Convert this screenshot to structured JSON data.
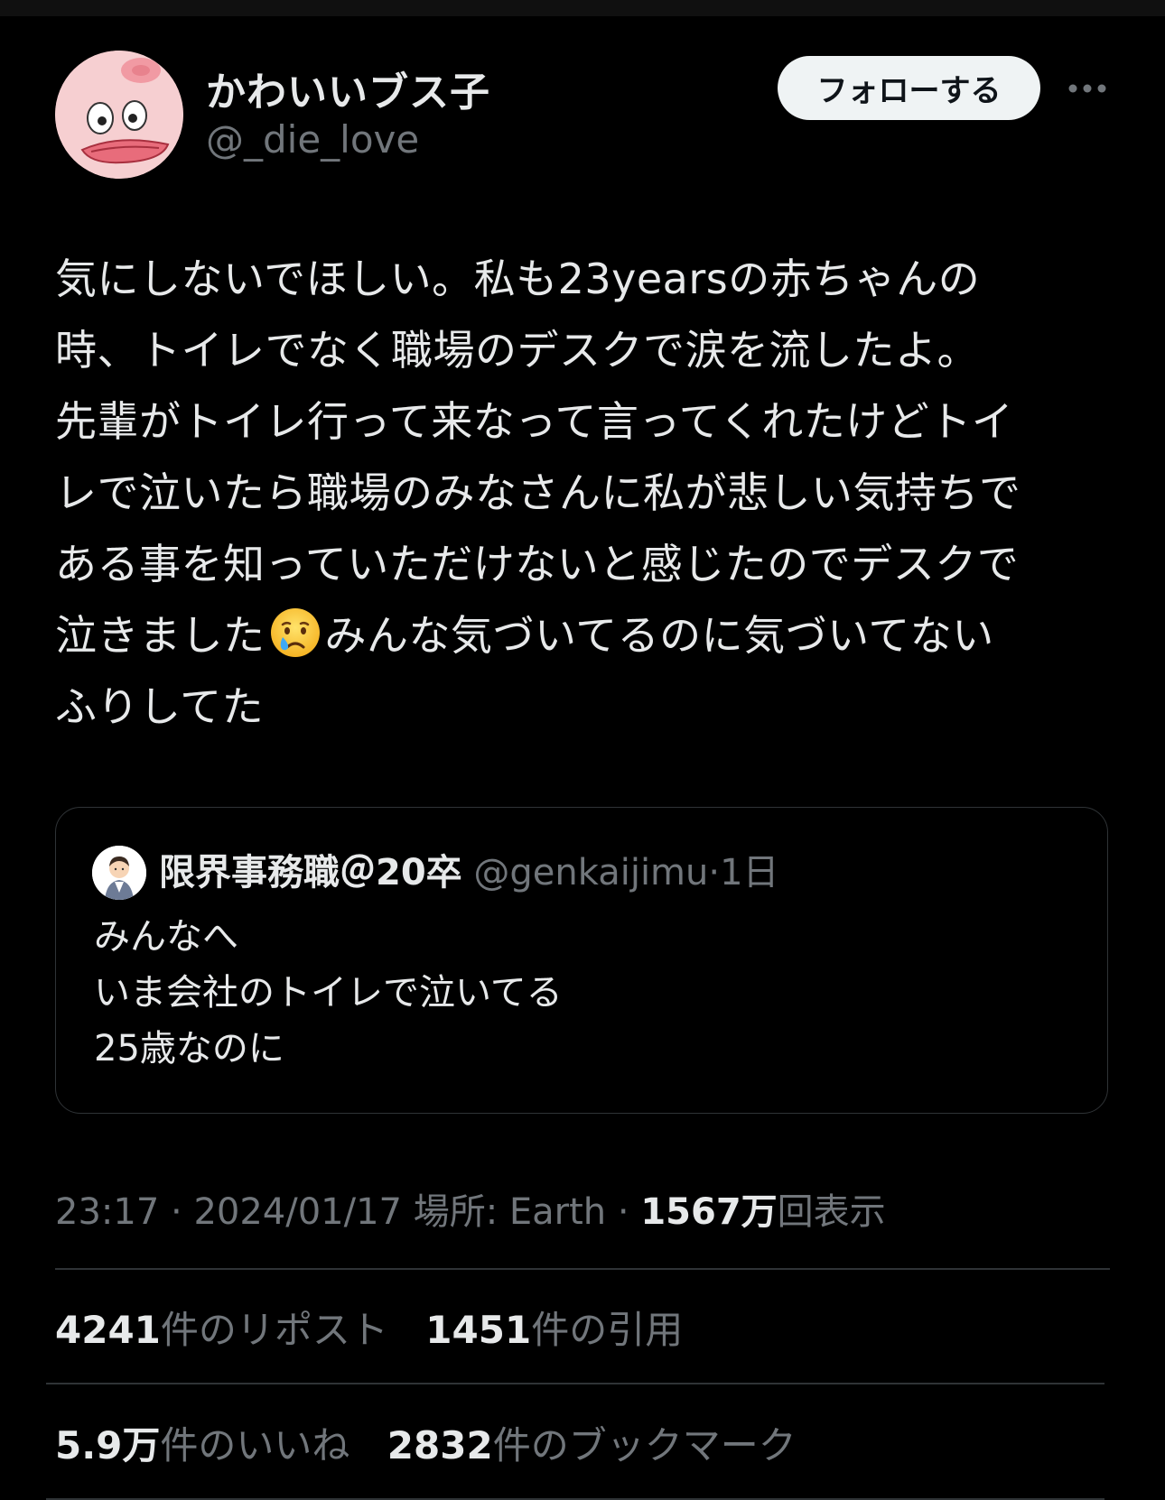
{
  "header": {
    "display_name": "かわいいブス子",
    "handle": "@_die_love",
    "follow_label": "フォローする"
  },
  "tweet": {
    "lines": [
      "気にしないでほしい。私も23yearsの赤ちゃんの",
      "時、トイレでなく職場のデスクで涙を流したよ。",
      "先輩がトイレ行って来なって言ってくれたけどトイ",
      "レで泣いたら職場のみなさんに私が悲しい気持ちで",
      "ある事を知っていただけないと感じたのでデスクで"
    ],
    "line6_before": "泣きました",
    "line6_after": "みんな気づいてるのに気づいてない",
    "line7": "ふりしてた",
    "emoji_name": "crying-face-icon"
  },
  "quote": {
    "name": "限界事務職＠20卒",
    "handle": "@genkaijimu",
    "separator": "·",
    "time": "1日",
    "lines": [
      "みんなへ",
      "いま会社のトイレで泣いてる",
      "25歳なのに"
    ]
  },
  "meta": {
    "time": "23:17",
    "sep1": "·",
    "date": "2024/01/17",
    "location": "場所: Earth",
    "sep2": "·",
    "views_number": "1567万",
    "views_label": "回表示"
  },
  "stats": {
    "reposts_number": "4241",
    "reposts_label": "件のリポスト",
    "quotes_number": "1451",
    "quotes_label": "件の引用",
    "likes_number": "5.9万",
    "likes_label": "件のいいね",
    "bookmarks_number": "2832",
    "bookmarks_label": "件のブックマーク"
  },
  "colors": {
    "background": "#000000",
    "text_primary": "#e7e9ea",
    "text_secondary": "#71767b",
    "divider": "#2f3336",
    "follow_bg": "#eff3f4"
  }
}
